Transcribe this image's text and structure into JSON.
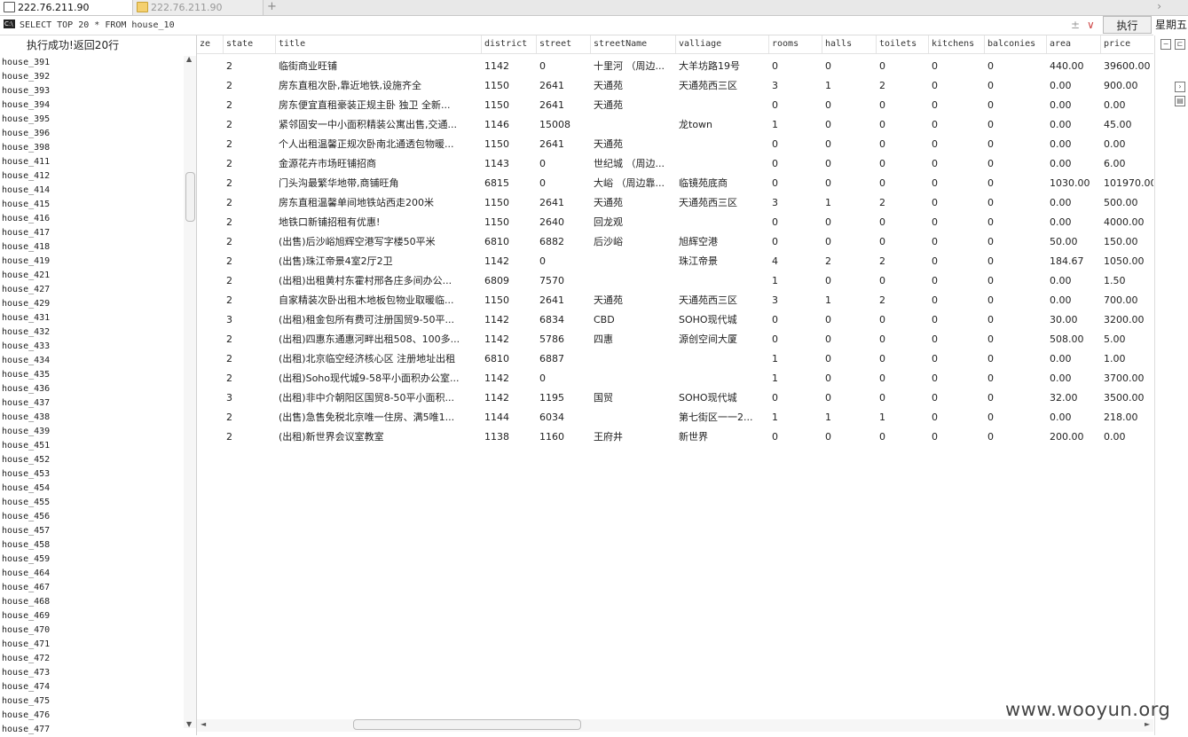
{
  "tabs": [
    {
      "label": "222.76.211.90"
    },
    {
      "label": "222.76.211.90"
    }
  ],
  "tab_add": "+",
  "tab_nav": "›",
  "query": {
    "text": "SELECT TOP 20 * FROM house_10",
    "ctrl_a": "±",
    "ctrl_b": "∨",
    "execute_label": "执行"
  },
  "weekday": "星期五",
  "status_text": "执行成功!返回20行",
  "table_list": [
    "house_391",
    "house_392",
    "house_393",
    "house_394",
    "house_395",
    "house_396",
    "house_398",
    "house_411",
    "house_412",
    "house_414",
    "house_415",
    "house_416",
    "house_417",
    "house_418",
    "house_419",
    "house_421",
    "house_427",
    "house_429",
    "house_431",
    "house_432",
    "house_433",
    "house_434",
    "house_435",
    "house_436",
    "house_437",
    "house_438",
    "house_439",
    "house_451",
    "house_452",
    "house_453",
    "house_454",
    "house_455",
    "house_456",
    "house_457",
    "house_458",
    "house_459",
    "house_464",
    "house_467",
    "house_468",
    "house_469",
    "house_470",
    "house_471",
    "house_472",
    "house_473",
    "house_474",
    "house_475",
    "house_476",
    "house_477"
  ],
  "columns": [
    "ze",
    "state",
    "title",
    "district",
    "street",
    "streetName",
    "valliage",
    "rooms",
    "halls",
    "toilets",
    "kitchens",
    "balconies",
    "area",
    "price"
  ],
  "rows": [
    [
      "",
      "2",
      "临街商业旺铺",
      "1142",
      "0",
      "十里河 （周边...",
      "大羊坊路19号",
      "0",
      "0",
      "0",
      "0",
      "0",
      "440.00",
      "39600.00"
    ],
    [
      "",
      "2",
      "房东直租次卧,靠近地铁,设施齐全",
      "1150",
      "2641",
      "天通苑",
      "天通苑西三区",
      "3",
      "1",
      "2",
      "0",
      "0",
      "0.00",
      "900.00"
    ],
    [
      "",
      "2",
      "房东便宜直租豪装正规主卧 独卫 全新...",
      "1150",
      "2641",
      "天通苑",
      "",
      "0",
      "0",
      "0",
      "0",
      "0",
      "0.00",
      "0.00"
    ],
    [
      "",
      "2",
      "紧邻固安一中小面积精装公寓出售,交通...",
      "1146",
      "15008",
      "",
      "龙town",
      "1",
      "0",
      "0",
      "0",
      "0",
      "0.00",
      "45.00"
    ],
    [
      "",
      "2",
      "个人出租温馨正规次卧南北通透包物暖...",
      "1150",
      "2641",
      "天通苑",
      "",
      "0",
      "0",
      "0",
      "0",
      "0",
      "0.00",
      "0.00"
    ],
    [
      "",
      "2",
      "金源花卉市场旺铺招商",
      "1143",
      "0",
      "世纪城 （周边...",
      "",
      "0",
      "0",
      "0",
      "0",
      "0",
      "0.00",
      "6.00"
    ],
    [
      "",
      "2",
      "门头沟最繁华地带,商铺旺角",
      "6815",
      "0",
      "大峪 （周边靠...",
      "临镜苑底商",
      "0",
      "0",
      "0",
      "0",
      "0",
      "1030.00",
      "101970.00"
    ],
    [
      "",
      "2",
      "房东直租温馨单间地铁站西走200米",
      "1150",
      "2641",
      "天通苑",
      "天通苑西三区",
      "3",
      "1",
      "2",
      "0",
      "0",
      "0.00",
      "500.00"
    ],
    [
      "",
      "2",
      "地铁口新铺招租有优惠!",
      "1150",
      "2640",
      "回龙观",
      "",
      "0",
      "0",
      "0",
      "0",
      "0",
      "0.00",
      "4000.00"
    ],
    [
      "",
      "2",
      "(出售)后沙峪旭辉空港写字楼50平米",
      "6810",
      "6882",
      "后沙峪",
      "旭辉空港",
      "0",
      "0",
      "0",
      "0",
      "0",
      "50.00",
      "150.00"
    ],
    [
      "",
      "2",
      "(出售)珠江帝景4室2厅2卫",
      "1142",
      "0",
      "",
      "珠江帝景",
      "4",
      "2",
      "2",
      "0",
      "0",
      "184.67",
      "1050.00"
    ],
    [
      "",
      "2",
      "(出租)出租黄村东霍村邢各庄多间办公...",
      "6809",
      "7570",
      "",
      "",
      "1",
      "0",
      "0",
      "0",
      "0",
      "0.00",
      "1.50"
    ],
    [
      "",
      "2",
      "自家精装次卧出租木地板包物业取暖临...",
      "1150",
      "2641",
      "天通苑",
      "天通苑西三区",
      "3",
      "1",
      "2",
      "0",
      "0",
      "0.00",
      "700.00"
    ],
    [
      "",
      "3",
      "(出租)租金包所有费可注册国贸9-50平...",
      "1142",
      "6834",
      "CBD",
      "SOHO现代城",
      "0",
      "0",
      "0",
      "0",
      "0",
      "30.00",
      "3200.00"
    ],
    [
      "",
      "2",
      "(出租)四惠东通惠河畔出租508、100多...",
      "1142",
      "5786",
      "四惠",
      "源创空间大厦",
      "0",
      "0",
      "0",
      "0",
      "0",
      "508.00",
      "5.00"
    ],
    [
      "",
      "2",
      "(出租)北京临空经济核心区 注册地址出租",
      "6810",
      "6887",
      "",
      "",
      "1",
      "0",
      "0",
      "0",
      "0",
      "0.00",
      "1.00"
    ],
    [
      "",
      "2",
      "(出租)Soho现代城9-58平小面积办公室...",
      "1142",
      "0",
      "",
      "",
      "1",
      "0",
      "0",
      "0",
      "0",
      "0.00",
      "3700.00"
    ],
    [
      "",
      "3",
      "(出租)非中介朝阳区国贸8-50平小面积...",
      "1142",
      "1195",
      "国贸",
      "SOHO现代城",
      "0",
      "0",
      "0",
      "0",
      "0",
      "32.00",
      "3500.00"
    ],
    [
      "",
      "2",
      "(出售)急售免税北京唯一住房、满5唯1...",
      "1144",
      "6034",
      "",
      "第七街区一一2...",
      "1",
      "1",
      "1",
      "0",
      "0",
      "0.00",
      "218.00"
    ],
    [
      "",
      "2",
      "(出租)新世界会议室教室",
      "1138",
      "1160",
      "王府井",
      "新世界",
      "0",
      "0",
      "0",
      "0",
      "0",
      "200.00",
      "0.00"
    ]
  ],
  "watermark": "www.wooyun.org"
}
